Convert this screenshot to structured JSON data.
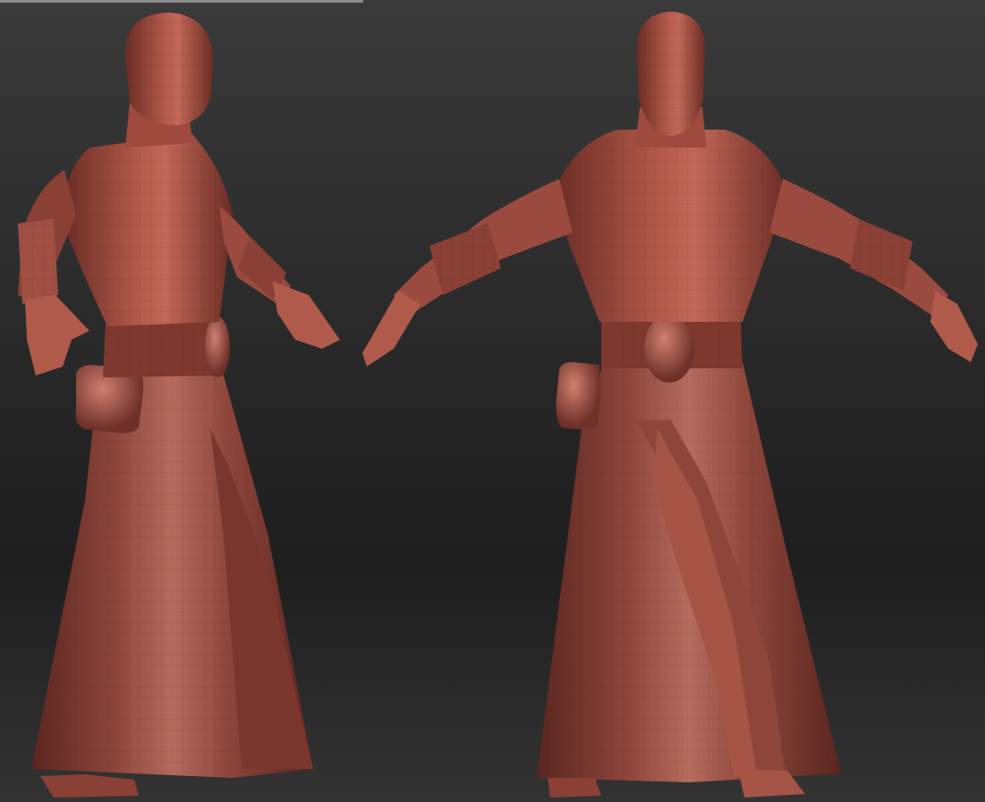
{
  "viewport": {
    "background_top": "#3a3a3a",
    "background_bottom": "#1e1e1e",
    "material_color": "#9e4a3e",
    "material_highlight": "#c9786a",
    "material_shadow": "#5a2620"
  },
  "models": [
    {
      "name": "figure-three-quarter-view",
      "pose": "A-pose",
      "view": "three-quarter"
    },
    {
      "name": "figure-front-view",
      "pose": "T-pose",
      "view": "front"
    }
  ]
}
